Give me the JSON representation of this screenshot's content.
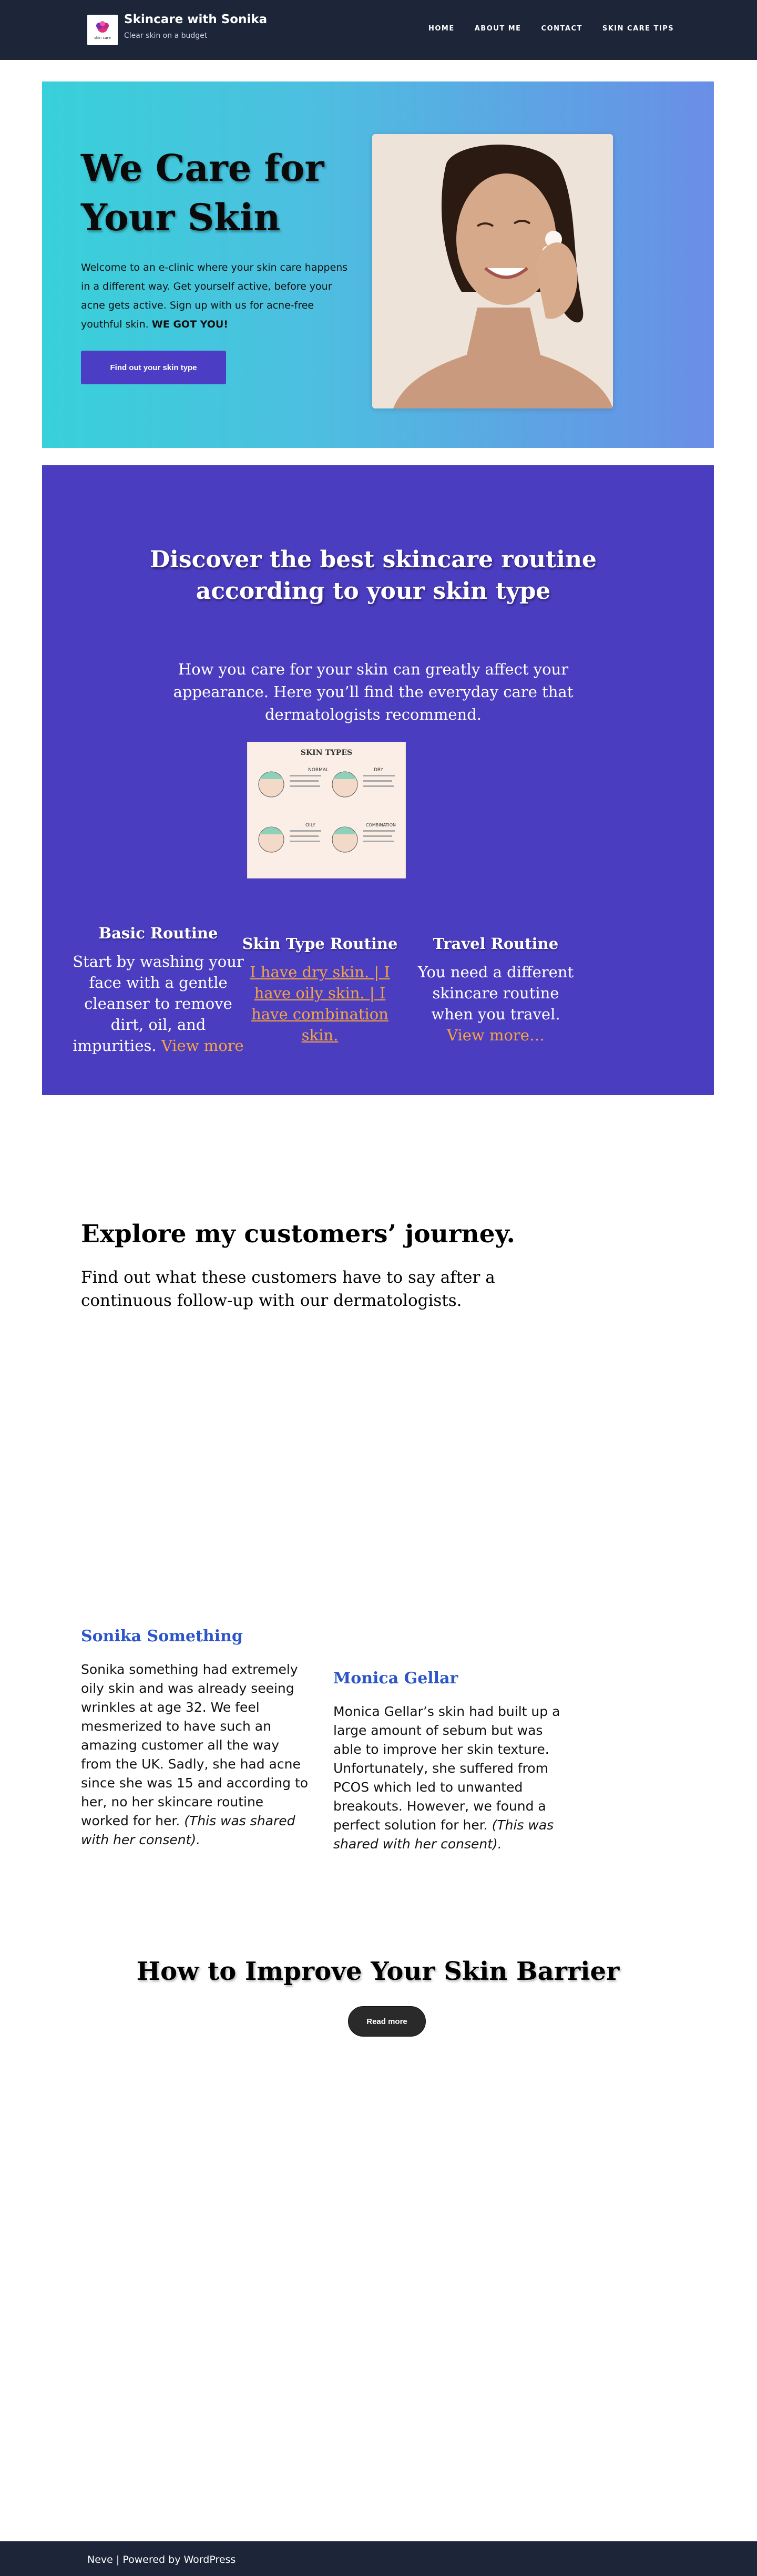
{
  "header": {
    "site_title": "Skincare with Sonika",
    "tagline": "Clear skin on a budget",
    "logo_text": "skin care",
    "nav": [
      {
        "label": "HOME"
      },
      {
        "label": "ABOUT ME"
      },
      {
        "label": "CONTACT"
      },
      {
        "label": "SKIN CARE TIPS"
      }
    ]
  },
  "hero": {
    "title": "We Care for Your Skin",
    "text": "Welcome to an e-clinic where your skin care happens in a different way. Get yourself active, before your acne gets active. Sign up with us for acne-free youthful skin.",
    "text_strong": "WE GOT YOU!",
    "button_label": "Find out your skin type"
  },
  "routine": {
    "title": "Discover the best skincare routine according to your skin type",
    "subtitle": "How you care for your skin can greatly affect your appearance. Here you’ll find the everyday care that dermatologists recommend.",
    "chart": {
      "title": "SKIN TYPES",
      "types": [
        "NORMAL",
        "DRY",
        "OILY",
        "COMBINATION"
      ]
    },
    "columns": [
      {
        "title": "Basic Routine",
        "text": "Start by washing your face with a gentle cleanser to remove dirt, oil, and impurities.",
        "link": "View more"
      },
      {
        "title": "Skin Type Routine",
        "links": [
          "I have dry skin. | I have oily skin. | I have combination skin."
        ]
      },
      {
        "title": "Travel Routine",
        "text": "You need a different skincare routine when you travel.",
        "link": "View more…"
      }
    ]
  },
  "journey": {
    "title": "Explore my customers’ journey.",
    "subtitle": "Find out what these customers have to say after a continuous follow-up with our dermatologists.",
    "testimonials": [
      {
        "name": "Sonika Something",
        "text": "Sonika something had extremely oily skin and was already seeing wrinkles at age 32. We feel mesmerized to have such an amazing customer all the way from the UK. Sadly, she had acne since she was 15 and according to her, no her skincare routine worked for her.",
        "note": "(This was shared with her consent)."
      },
      {
        "name": "Monica Gellar",
        "text": "Monica Gellar’s skin had built up a large amount of sebum but was able to improve her skin texture. Unfortunately, she suffered from PCOS which led to unwanted breakouts. However, we found a perfect solution for her.",
        "note": "(This was shared with her consent)."
      }
    ]
  },
  "barrier": {
    "title": "How to Improve Your Skin Barrier",
    "button_label": "Read more"
  },
  "footer": {
    "text": "Neve | Powered by WordPress"
  },
  "colors": {
    "header_bg": "#1d2539",
    "hero_gradient_start": "#38d0da",
    "hero_gradient_end": "#6a8ee6",
    "accent_purple": "#4b3ec4",
    "link_orange": "#f4a640",
    "name_blue": "#2c55c9"
  }
}
